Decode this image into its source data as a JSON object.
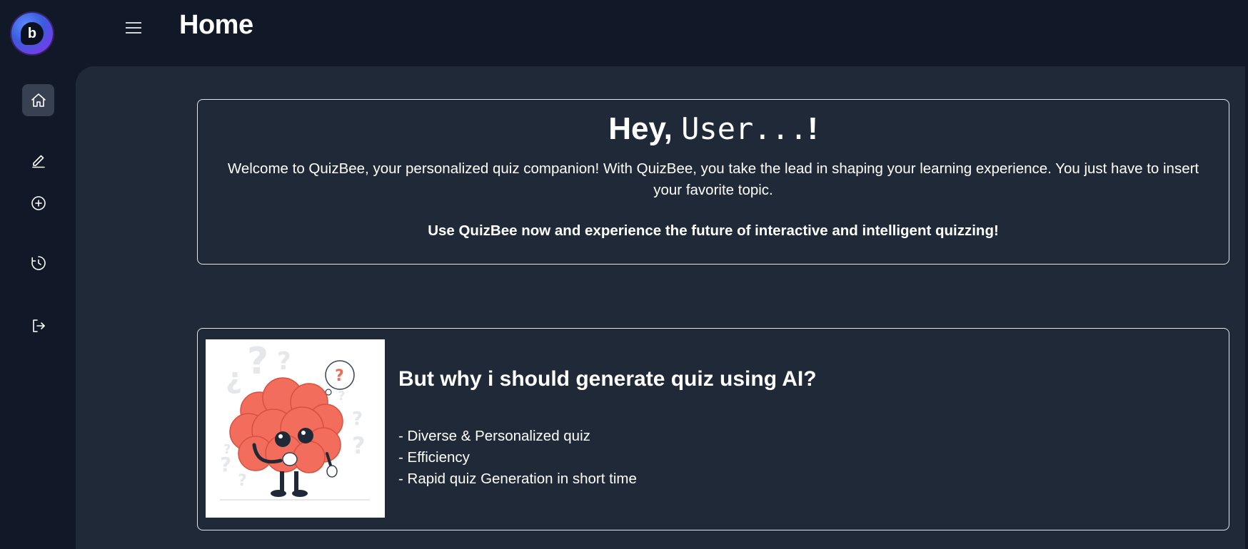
{
  "app": {
    "logo_letter": "b",
    "accent_color": "#7c3aed"
  },
  "header": {
    "title": "Home",
    "menu_icon": "hamburger-icon"
  },
  "sidebar": {
    "items": [
      {
        "icon": "home-icon",
        "active": true
      },
      {
        "icon": "pencil-icon",
        "active": false
      },
      {
        "icon": "plus-circle-icon",
        "active": false
      },
      {
        "icon": "history-icon",
        "active": false
      },
      {
        "icon": "logout-icon",
        "active": false
      }
    ]
  },
  "welcome": {
    "greeting_prefix": "Hey,",
    "username": "User...",
    "greeting_suffix": "!",
    "description": "Welcome to QuizBee, your personalized quiz companion! With QuizBee, you take the lead in shaping your learning experience. You just have to insert your favorite topic.",
    "cta": "Use QuizBee now and experience the future of interactive and intelligent quizzing!"
  },
  "why": {
    "title": "But why i should generate quiz using AI?",
    "points": [
      "- Diverse & Personalized quiz",
      "- Efficiency",
      "- Rapid quiz Generation in short time"
    ],
    "illustration": "thinking-brain-illustration"
  }
}
